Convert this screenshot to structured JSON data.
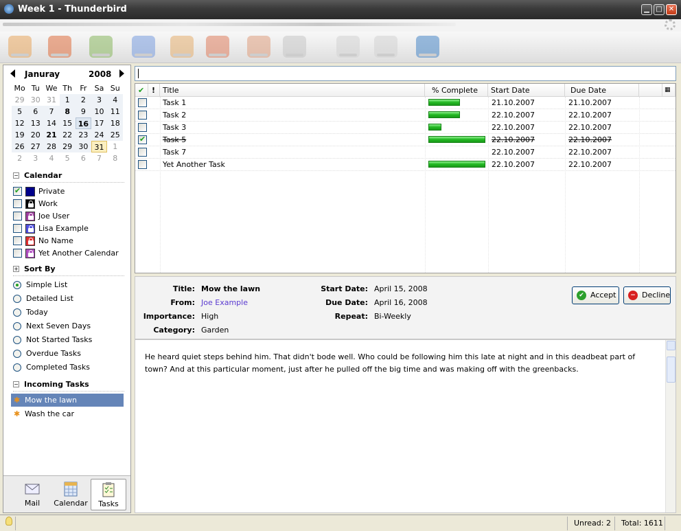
{
  "window": {
    "title": "Week 1 - Thunderbird"
  },
  "calendar": {
    "month": "Januray",
    "year": "2008",
    "weekdays": [
      "Mo",
      "Tu",
      "We",
      "Th",
      "Fr",
      "Sa",
      "Su"
    ],
    "weeks": [
      [
        "29",
        "30",
        "31",
        "1",
        "2",
        "3",
        "4"
      ],
      [
        "5",
        "6",
        "7",
        "8",
        "9",
        "10",
        "11"
      ],
      [
        "12",
        "13",
        "14",
        "15",
        "16",
        "17",
        "18"
      ],
      [
        "19",
        "20",
        "21",
        "22",
        "23",
        "24",
        "25"
      ],
      [
        "26",
        "27",
        "28",
        "29",
        "30",
        "31",
        "1"
      ],
      [
        "2",
        "3",
        "4",
        "5",
        "6",
        "7",
        "8"
      ]
    ]
  },
  "calendars_section": {
    "title": "Calendar",
    "items": [
      {
        "label": "Private",
        "checked": true,
        "color": "#00008b"
      },
      {
        "label": "Work",
        "checked": false,
        "color": "#000000"
      },
      {
        "label": "Joe User",
        "checked": false,
        "color": "#a040a0"
      },
      {
        "label": "Lisa Example",
        "checked": false,
        "color": "#5050e0"
      },
      {
        "label": "No Name",
        "checked": false,
        "color": "#e03030"
      },
      {
        "label": "Yet Another Calendar",
        "checked": false,
        "color": "#b050c0"
      }
    ]
  },
  "sort_section": {
    "title": "Sort By",
    "items": [
      "Simple List",
      "Detailed List",
      "Today",
      "Next Seven Days",
      "Not Started Tasks",
      "Overdue Tasks",
      "Completed Tasks"
    ],
    "selected": "Simple List"
  },
  "incoming_section": {
    "title": "Incoming Tasks",
    "items": [
      "Mow the lawn",
      "Wash the car"
    ],
    "selected": "Mow the lawn"
  },
  "switcher": {
    "mail": "Mail",
    "calendar": "Calendar",
    "tasks": "Tasks"
  },
  "task_table": {
    "columns": {
      "title": "Title",
      "percent": "% Complete",
      "start": "Start Date",
      "due": "Due Date"
    },
    "rows": [
      {
        "title": "Task 1",
        "percent": 55,
        "start": "21.10.2007",
        "due": "21.10.2007",
        "done": false
      },
      {
        "title": "Task 2",
        "percent": 55,
        "start": "22.10.2007",
        "due": "22.10.2007",
        "done": false
      },
      {
        "title": "Task 3",
        "percent": 23,
        "start": "22.10.2007",
        "due": "22.10.2007",
        "done": false
      },
      {
        "title": "Task 5",
        "percent": 100,
        "start": "22.10.2007",
        "due": "22.10.2007",
        "done": true
      },
      {
        "title": "Task 7",
        "percent": 0,
        "start": "22.10.2007",
        "due": "22.10.2007",
        "done": false
      },
      {
        "title": "Yet Another Task",
        "percent": 100,
        "start": "22.10.2007",
        "due": "22.10.2007",
        "done": false
      }
    ]
  },
  "details": {
    "labels": {
      "title": "Title:",
      "from": "From:",
      "importance": "Importance:",
      "category": "Category:",
      "start": "Start Date:",
      "due": "Due Date:",
      "repeat": "Repeat:"
    },
    "title": "Mow the lawn",
    "from": "Joe Example",
    "importance": "High",
    "category": "Garden",
    "start": "April 15,  2008",
    "due": "April 16,  2008",
    "repeat": "Bi-Weekly",
    "accept": "Accept",
    "decline": "Decline"
  },
  "body_text": "He heard quiet steps behind him. That didn't bode well. Who could be following him this late at night and in this deadbeat part of town? And at this particular moment, just after he pulled off the big time and was making off with the greenbacks.",
  "status": {
    "unread": "Unread: 2",
    "total": "Total: 1611"
  }
}
